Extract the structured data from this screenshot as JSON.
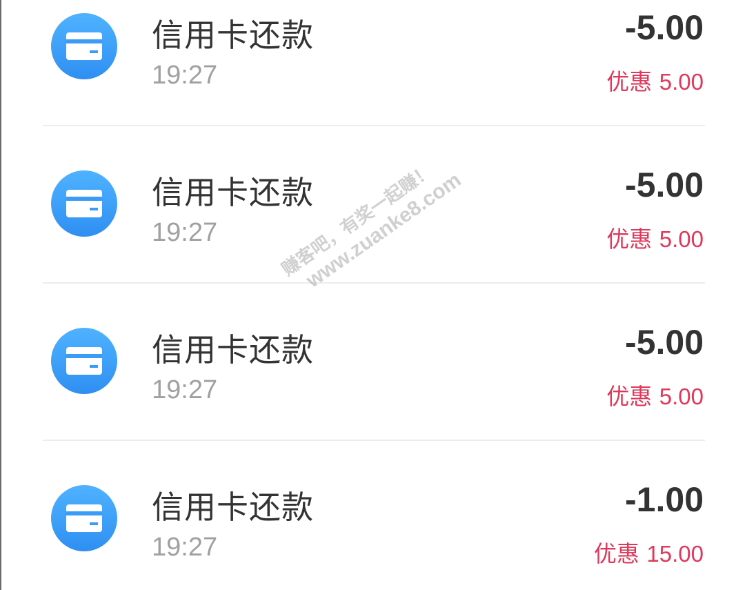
{
  "transactions": [
    {
      "title": "信用卡还款",
      "time": "19:27",
      "amount": "-5.00",
      "discount_label": "优惠",
      "discount_value": "5.00",
      "icon": "credit-card-icon"
    },
    {
      "title": "信用卡还款",
      "time": "19:27",
      "amount": "-5.00",
      "discount_label": "优惠",
      "discount_value": "5.00",
      "icon": "credit-card-icon"
    },
    {
      "title": "信用卡还款",
      "time": "19:27",
      "amount": "-5.00",
      "discount_label": "优惠",
      "discount_value": "5.00",
      "icon": "credit-card-icon"
    },
    {
      "title": "信用卡还款",
      "time": "19:27",
      "amount": "-1.00",
      "discount_label": "优惠",
      "discount_value": "15.00",
      "icon": "credit-card-icon"
    }
  ],
  "watermark": {
    "line1": "赚客吧，有奖一起赚！",
    "line2": "www.zuanke8.com"
  },
  "colors": {
    "icon_bg": "#3a9cf7",
    "title": "#333333",
    "time": "#a0a0a0",
    "amount": "#333333",
    "discount": "#e0385c",
    "divider": "#ececec"
  }
}
